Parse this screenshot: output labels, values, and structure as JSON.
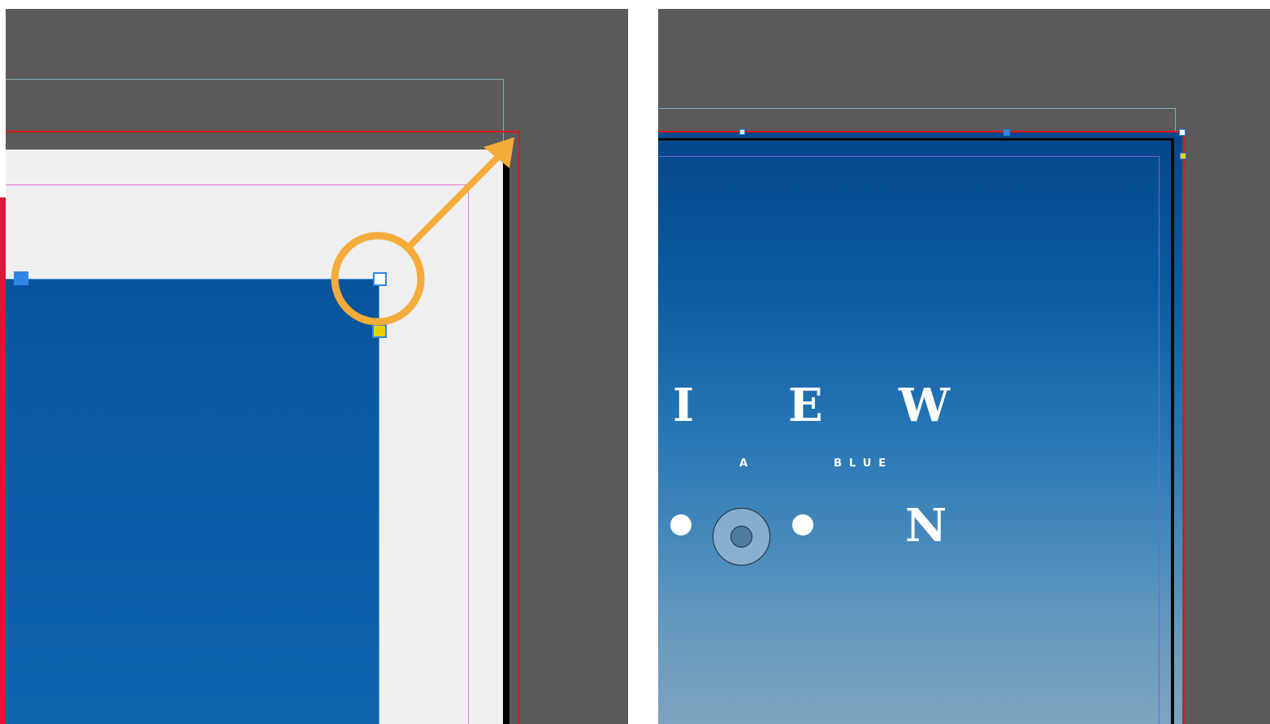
{
  "colors": {
    "pasteboard": "#5a5a5a",
    "bleed_guide": "#e0151b",
    "margin_guide": "#e37ae6",
    "slug_guide": "#7fb0c4",
    "image_blue": "#0a5ea6",
    "page_paper": "#efefef",
    "callout_orange": "#f5ac3b",
    "selection_handle": "#2f86e6",
    "content_grabber": "#e6d200"
  },
  "left_panel": {
    "callout": "orange-circle-and-arrow",
    "icons": [
      "corner-handle-icon",
      "anchor-handle-icon",
      "yellow-handle-icon",
      "arrow-icon"
    ]
  },
  "right_panel": {
    "poster_text": {
      "row1": [
        "I",
        "E",
        "W"
      ],
      "row2": [
        "A",
        "BLUE"
      ],
      "row3": [
        "N"
      ]
    },
    "icons": [
      "dot-icon",
      "content-grabber-icon",
      "dot-icon"
    ]
  }
}
